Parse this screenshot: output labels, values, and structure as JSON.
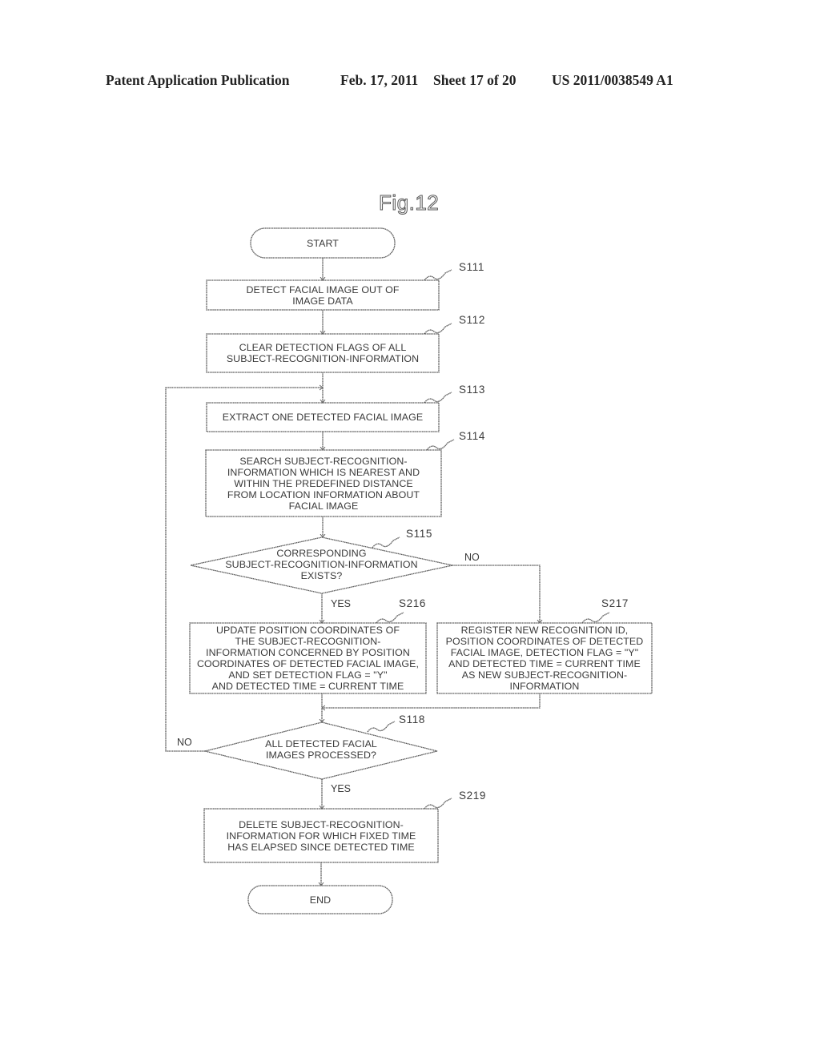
{
  "header": {
    "publication": "Patent Application Publication",
    "date": "Feb. 17, 2011",
    "sheet": "Sheet 17 of 20",
    "number": "US 2011/0038549 A1"
  },
  "figure": {
    "title": "Fig.12",
    "nodes": {
      "start": {
        "type": "terminal",
        "text": "START"
      },
      "s111": {
        "type": "process",
        "step": "S111",
        "text": "DETECT FACIAL IMAGE OUT OF\nIMAGE DATA"
      },
      "s112": {
        "type": "process",
        "step": "S112",
        "text": "CLEAR DETECTION FLAGS OF ALL\nSUBJECT-RECOGNITION-INFORMATION"
      },
      "s113": {
        "type": "process",
        "step": "S113",
        "text": "EXTRACT ONE DETECTED FACIAL IMAGE"
      },
      "s114": {
        "type": "process",
        "step": "S114",
        "text": "SEARCH SUBJECT-RECOGNITION-\nINFORMATION WHICH IS NEAREST AND\nWITHIN THE PREDEFINED DISTANCE\nFROM LOCATION INFORMATION ABOUT\nFACIAL IMAGE"
      },
      "s115": {
        "type": "decision",
        "step": "S115",
        "text": "CORRESPONDING\nSUBJECT-RECOGNITION-INFORMATION\nEXISTS?"
      },
      "s216": {
        "type": "process",
        "step": "S216",
        "text": "UPDATE POSITION COORDINATES OF\nTHE SUBJECT-RECOGNITION-\nINFORMATION CONCERNED BY POSITION\nCOORDINATES OF DETECTED FACIAL IMAGE,\nAND SET DETECTION FLAG = \"Y\"\nAND DETECTED TIME = CURRENT TIME"
      },
      "s217": {
        "type": "process",
        "step": "S217",
        "text": "REGISTER NEW RECOGNITION ID,\nPOSITION COORDINATES OF DETECTED\nFACIAL IMAGE, DETECTION FLAG = \"Y\"\nAND DETECTED TIME = CURRENT TIME\nAS NEW SUBJECT-RECOGNITION-\nINFORMATION"
      },
      "s118": {
        "type": "decision",
        "step": "S118",
        "text": "ALL DETECTED FACIAL\nIMAGES PROCESSED?"
      },
      "s219": {
        "type": "process",
        "step": "S219",
        "text": "DELETE SUBJECT-RECOGNITION-\nINFORMATION FOR WHICH FIXED TIME\nHAS ELAPSED SINCE DETECTED TIME"
      },
      "end": {
        "type": "terminal",
        "text": "END"
      }
    },
    "branches": {
      "s115_yes": "YES",
      "s115_no": "NO",
      "s118_yes": "YES",
      "s118_no": "NO"
    },
    "edges": [
      [
        "start",
        "s111"
      ],
      [
        "s111",
        "s112"
      ],
      [
        "s112",
        "s113"
      ],
      [
        "s113",
        "s114"
      ],
      [
        "s114",
        "s115"
      ],
      [
        "s115",
        "s216",
        "YES"
      ],
      [
        "s115",
        "s217",
        "NO"
      ],
      [
        "s216",
        "s118"
      ],
      [
        "s217",
        "s118"
      ],
      [
        "s118",
        "s113",
        "NO"
      ],
      [
        "s118",
        "s219",
        "YES"
      ],
      [
        "s219",
        "end"
      ]
    ]
  }
}
